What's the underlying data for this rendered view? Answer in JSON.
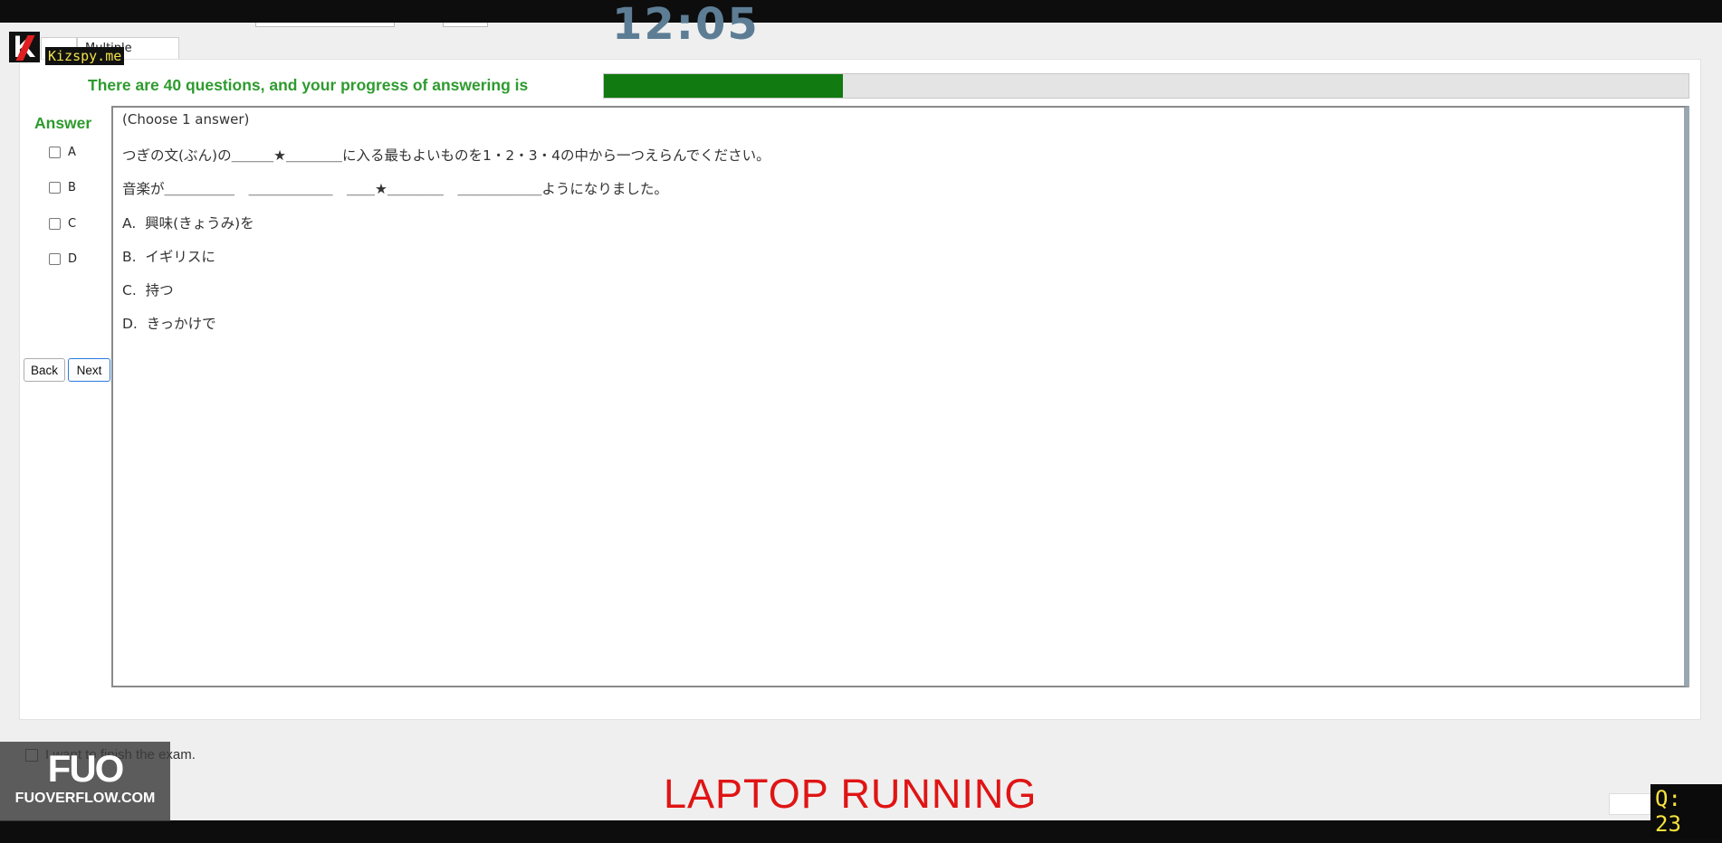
{
  "exam": {
    "timer": "12:05",
    "tabs": [
      "…",
      "Multiple Choices"
    ],
    "progress_text": "There are 40 questions, and your progress of answering is",
    "progress_fraction": 0.22,
    "answer_label": "Answer",
    "options": [
      "A",
      "B",
      "C",
      "D"
    ],
    "back_label": "Back",
    "next_label": "Next",
    "question": {
      "instruction": "(Choose 1 answer)",
      "prompt": "つぎの文(ぶん)の＿＿＿★＿＿＿＿に入る最もよいものを1・2・3・4の中から一つえらんでください。",
      "sentence": "音楽が＿＿＿＿＿　＿＿＿＿＿＿　＿＿★＿＿＿＿　＿＿＿＿＿＿ようになりました。",
      "choices": [
        "A.  興味(きょうみ)を",
        "B.  イギリスに",
        "C.  持つ",
        "D.  きっかけで"
      ]
    },
    "finish_label": "I want to finish the exam."
  },
  "overlays": {
    "laptop_running": "LAPTOP RUNNING",
    "kizspy": "Kizspy.me",
    "fuo_big": "FUO",
    "fuo_small": "FUOVERFLOW.COM",
    "question_counter": "Q: 23"
  },
  "colors": {
    "accent_green": "#2e9b2e",
    "progress_green": "#117a11",
    "warning_red": "#e01414",
    "timer_blue": "#5d7d95"
  }
}
